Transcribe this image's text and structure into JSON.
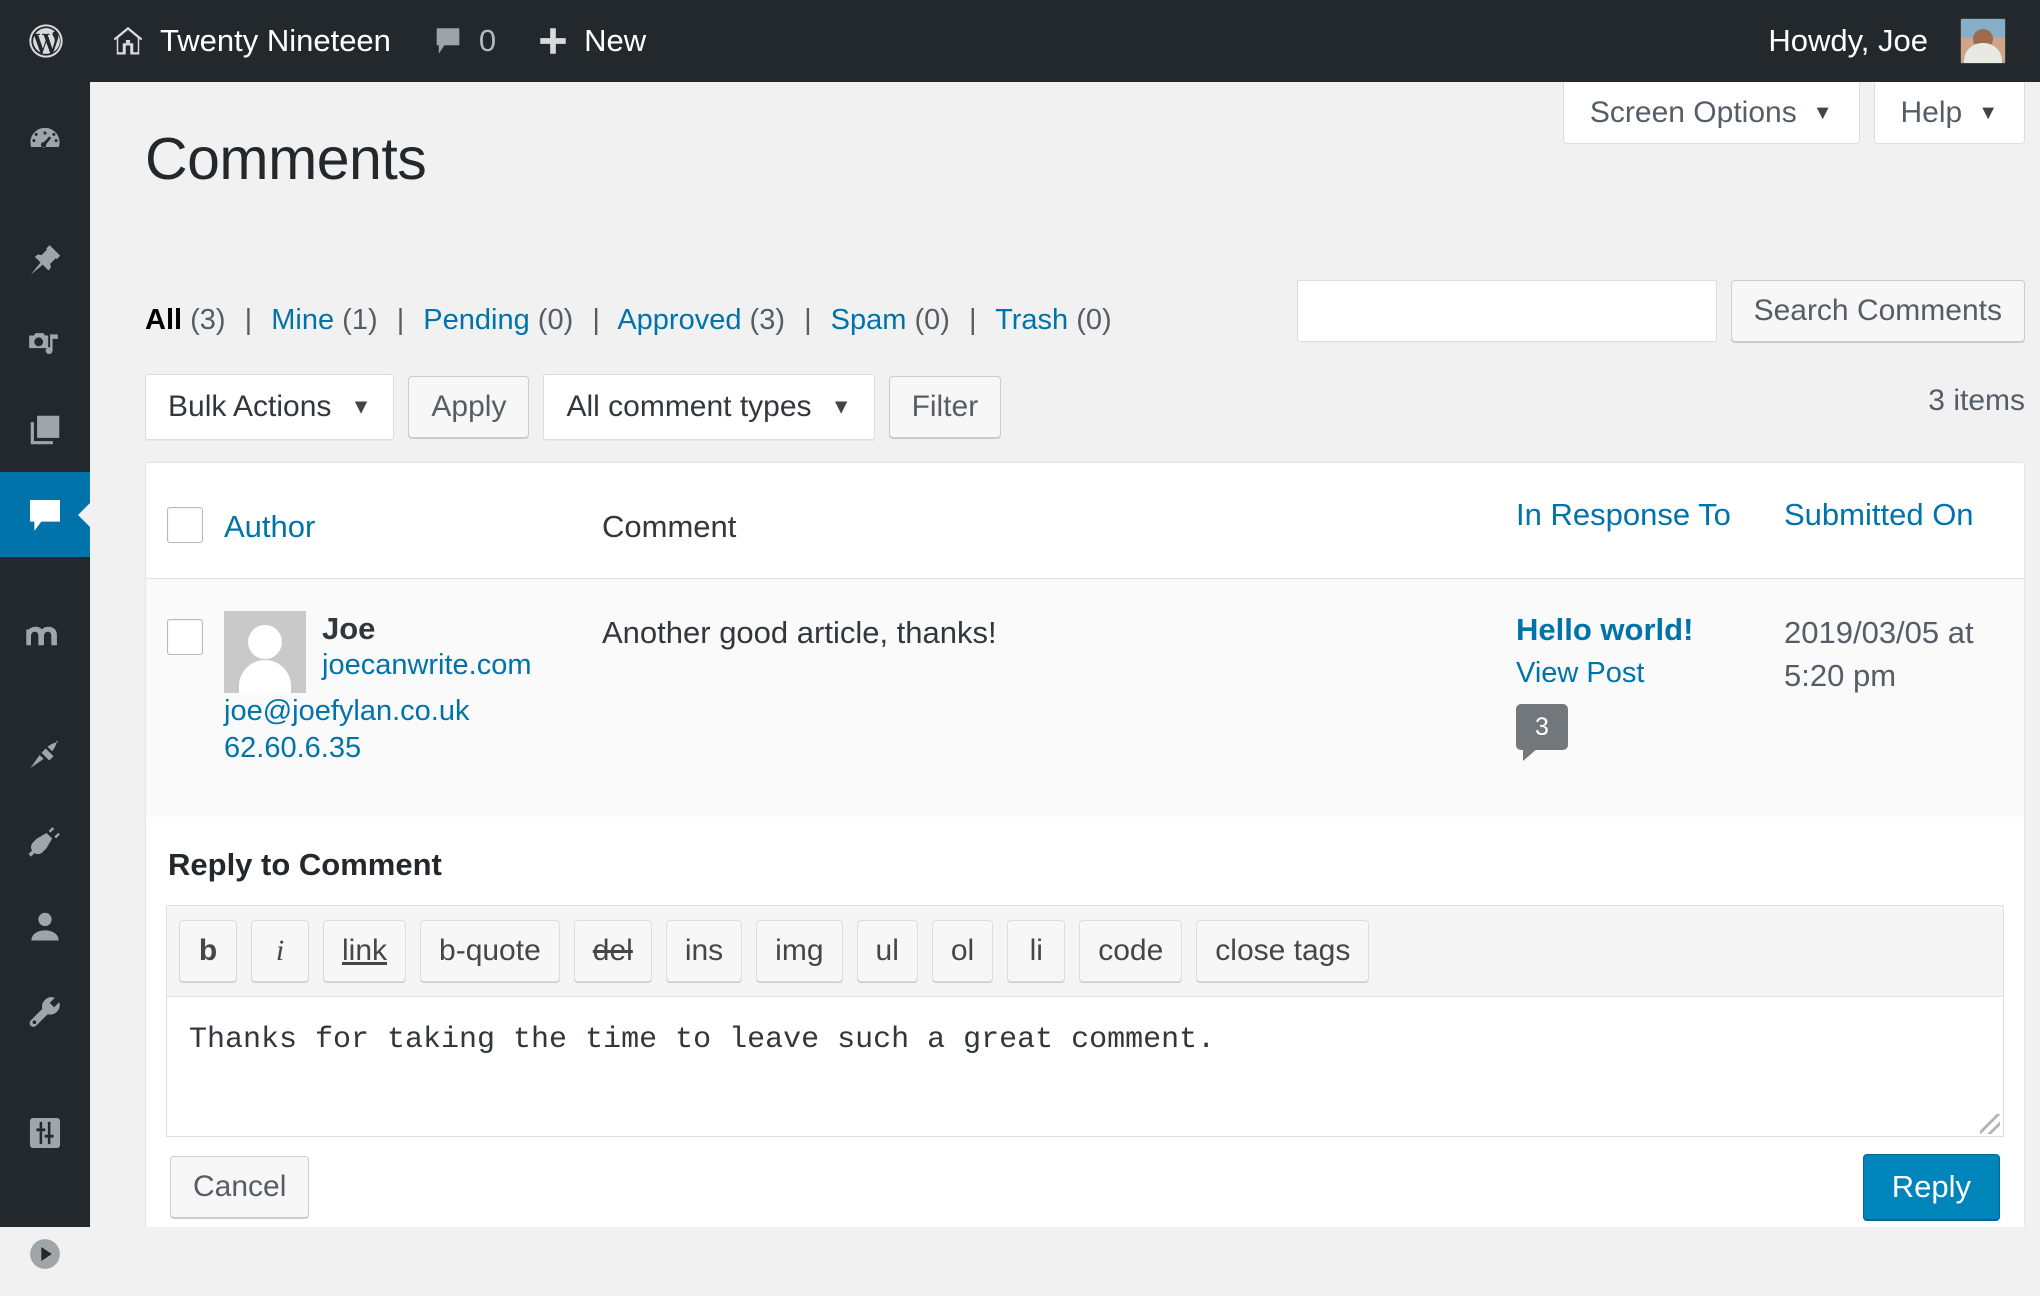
{
  "adminbar": {
    "wp_logo_icon": "wordpress-logo-icon",
    "home_icon": "home-icon",
    "site_name": "Twenty Nineteen",
    "comments_icon": "comment-bubble-icon",
    "comments_count": "0",
    "plus_icon": "plus-icon",
    "new_label": "New",
    "howdy": "Howdy, Joe",
    "avatar_icon": "user-avatar"
  },
  "sidebar": {
    "items": [
      {
        "name": "dashboard",
        "icon": "dashboard-gauge-icon",
        "current": false
      },
      {
        "name": "posts",
        "icon": "pin-icon",
        "current": false
      },
      {
        "name": "media",
        "icon": "camera-music-icon",
        "current": false
      },
      {
        "name": "pages",
        "icon": "pages-stack-icon",
        "current": false
      },
      {
        "name": "comments",
        "icon": "comment-bubble-icon",
        "current": true
      },
      {
        "name": "monsterinsights",
        "icon": "letter-m-icon",
        "current": false
      },
      {
        "name": "appearance",
        "icon": "paintbrush-icon",
        "current": false
      },
      {
        "name": "plugins",
        "icon": "plug-icon",
        "current": false
      },
      {
        "name": "users",
        "icon": "user-icon",
        "current": false
      },
      {
        "name": "tools",
        "icon": "wrench-icon",
        "current": false
      },
      {
        "name": "settings",
        "icon": "sliders-icon",
        "current": false
      },
      {
        "name": "collapse-menu",
        "icon": "play-circle-icon",
        "current": false
      }
    ]
  },
  "screen_meta": {
    "screen_options": "Screen Options",
    "help": "Help",
    "caret": "▼"
  },
  "page": {
    "title": "Comments"
  },
  "filters": {
    "links": [
      {
        "label": "All",
        "count": "(3)",
        "current": true
      },
      {
        "label": "Mine",
        "count": "(1)",
        "current": false
      },
      {
        "label": "Pending",
        "count": "(0)",
        "current": false
      },
      {
        "label": "Approved",
        "count": "(3)",
        "current": false
      },
      {
        "label": "Spam",
        "count": "(0)",
        "current": false
      },
      {
        "label": "Trash",
        "count": "(0)",
        "current": false
      }
    ],
    "separator": "|"
  },
  "search": {
    "value": "",
    "placeholder": "",
    "button": "Search Comments"
  },
  "tablenav": {
    "bulk_actions": "Bulk Actions",
    "apply": "Apply",
    "comment_types": "All comment types",
    "filter": "Filter",
    "items_count": "3 items",
    "caret": "▼"
  },
  "table": {
    "columns": {
      "author": "Author",
      "comment": "Comment",
      "in_response_to": "In Response To",
      "submitted_on": "Submitted On"
    },
    "rows": [
      {
        "author_name": "Joe",
        "author_url": "joecanwrite.com",
        "author_email": "joe@joefylan.co.uk",
        "author_ip": "62.60.6.35",
        "comment": "Another good article, thanks!",
        "response_post": "Hello world!",
        "view_post": "View Post",
        "response_count": "3",
        "submitted_date": "2019/03/05 at",
        "submitted_time": "5:20 pm"
      }
    ]
  },
  "reply": {
    "heading": "Reply to Comment",
    "toolbar": [
      {
        "label": "b",
        "style": "b"
      },
      {
        "label": "i",
        "style": "i"
      },
      {
        "label": "link",
        "style": "u"
      },
      {
        "label": "b-quote",
        "style": ""
      },
      {
        "label": "del",
        "style": "s"
      },
      {
        "label": "ins",
        "style": ""
      },
      {
        "label": "img",
        "style": ""
      },
      {
        "label": "ul",
        "style": ""
      },
      {
        "label": "ol",
        "style": ""
      },
      {
        "label": "li",
        "style": ""
      },
      {
        "label": "code",
        "style": ""
      },
      {
        "label": "close tags",
        "style": ""
      }
    ],
    "text": "Thanks for taking the time to leave such a great comment.",
    "placeholder": "",
    "cancel": "Cancel",
    "submit": "Reply"
  },
  "colors": {
    "accent": "#0073aa",
    "primary_button": "#0085ba",
    "adminbar": "#23282d",
    "page_bg": "#f1f1f1",
    "bubble": "#72777c"
  }
}
